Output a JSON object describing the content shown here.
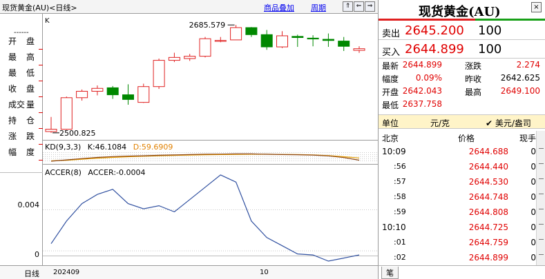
{
  "topbar": {
    "title": "现货黄金(AU)<日线>",
    "link_overlay": "商品叠加",
    "link_period": "周期"
  },
  "lefttoolbar": {
    "dash": "------",
    "items": [
      {
        "a": "开",
        "b": "盘"
      },
      {
        "a": "最",
        "b": "高"
      },
      {
        "a": "最",
        "b": "低"
      },
      {
        "a": "收",
        "b": "盘"
      },
      {
        "a": "成交",
        "b": "量"
      },
      {
        "a": "持",
        "b": "仓"
      },
      {
        "a": "涨",
        "b": "跌"
      },
      {
        "a": "幅",
        "b": "度"
      }
    ]
  },
  "bottombar": {
    "period": "日线",
    "date_start": "202409",
    "date_mid": "10"
  },
  "chart_data": {
    "type": "candlestick",
    "main_label": "K",
    "candles": [
      {
        "o": 2503,
        "h": 2528,
        "l": 2500.825,
        "c": 2507
      },
      {
        "o": 2507,
        "h": 2563,
        "l": 2506,
        "c": 2561
      },
      {
        "o": 2561,
        "h": 2575,
        "l": 2556,
        "c": 2572
      },
      {
        "o": 2572,
        "h": 2582,
        "l": 2565,
        "c": 2577
      },
      {
        "o": 2578,
        "h": 2581,
        "l": 2559,
        "c": 2566
      },
      {
        "o": 2566,
        "h": 2584,
        "l": 2549,
        "c": 2558
      },
      {
        "o": 2553,
        "h": 2585,
        "l": 2552,
        "c": 2580
      },
      {
        "o": 2580,
        "h": 2628,
        "l": 2576,
        "c": 2625
      },
      {
        "o": 2625,
        "h": 2638,
        "l": 2622,
        "c": 2630
      },
      {
        "o": 2628,
        "h": 2636,
        "l": 2624,
        "c": 2632
      },
      {
        "o": 2632,
        "h": 2665,
        "l": 2630,
        "c": 2662
      },
      {
        "o": 2658,
        "h": 2665,
        "l": 2656,
        "c": 2659
      },
      {
        "o": 2660,
        "h": 2685.579,
        "l": 2660,
        "c": 2681
      },
      {
        "o": 2681,
        "h": 2682,
        "l": 2665,
        "c": 2669
      },
      {
        "o": 2669,
        "h": 2677,
        "l": 2643,
        "c": 2648
      },
      {
        "o": 2648,
        "h": 2675,
        "l": 2646,
        "c": 2667
      },
      {
        "o": 2666,
        "h": 2669,
        "l": 2648,
        "c": 2664
      },
      {
        "o": 2663,
        "h": 2668,
        "l": 2649,
        "c": 2662
      },
      {
        "o": 2661,
        "h": 2671,
        "l": 2648,
        "c": 2659
      },
      {
        "o": 2658,
        "h": 2665,
        "l": 2641,
        "c": 2649
      },
      {
        "o": 2642.043,
        "h": 2649.1,
        "l": 2637.758,
        "c": 2644.899
      }
    ],
    "max_label": "2685.579",
    "min_label": "2500.825",
    "price_range": [
      2490,
      2700
    ],
    "kd": {
      "label": "KD(9,3,3)",
      "k_label": "K:46.1084",
      "d_label": "D:59.6909",
      "k": [
        40,
        48,
        56,
        63,
        68,
        71,
        73,
        76,
        78,
        80,
        82,
        83,
        84,
        84,
        82,
        80,
        79,
        77,
        72,
        62,
        46.1084
      ],
      "d": [
        42,
        46,
        52,
        58,
        63,
        67,
        70,
        73,
        75,
        77,
        79,
        80,
        81,
        82,
        82,
        81,
        80,
        78,
        74,
        67,
        59.6909
      ],
      "k_color": "#8b4513",
      "d_color": "#e8a000"
    },
    "accer": {
      "label": "ACCER(8)",
      "value_label": "ACCER:-0.0004",
      "values": [
        0.0007,
        0.0029,
        0.0046,
        0.0055,
        0.006,
        0.0046,
        0.0041,
        0.0044,
        0.0038,
        0.005,
        0.0062,
        0.0074,
        0.0067,
        0.0029,
        0.0013,
        0.0005,
        -0.0003,
        -0.0004,
        -0.001,
        -0.0007,
        -0.0004
      ],
      "ylim": [
        -0.0012,
        0.0082
      ],
      "ticks": [
        "0.004",
        "0"
      ],
      "color": "#3050a0"
    }
  },
  "rightpanel": {
    "title": "现货黄金(AU)",
    "close_icon": "×",
    "sell_label": "卖出",
    "sell_price": "2645.200",
    "sell_qty": "100",
    "buy_label": "买入",
    "buy_price": "2644.899",
    "buy_qty": "100",
    "stats": [
      {
        "k": "最新",
        "v": "2644.899",
        "vc": "#e00000",
        "k2": "涨跌",
        "v2": "2.274",
        "v2c": "#e00000"
      },
      {
        "k": "幅度",
        "v": "0.09%",
        "vc": "#e00000",
        "k2": "昨收",
        "v2": "2642.625",
        "v2c": "#000000"
      },
      {
        "k": "开盘",
        "v": "2642.043",
        "vc": "#e00000",
        "k2": "最高",
        "v2": "2649.100",
        "v2c": "#e00000"
      },
      {
        "k": "最低",
        "v": "2637.758",
        "vc": "#e00000",
        "k2": "",
        "v2": "",
        "v2c": "#000000"
      }
    ],
    "unit_label": "单位",
    "unit_value": "元/克",
    "unit_check": "✔ 美元/盎司",
    "col_time": "北京",
    "col_price": "价格",
    "col_hand": "现手",
    "ticks": [
      {
        "t": "10:09",
        "sub": false,
        "p": "2644.688",
        "h": "0"
      },
      {
        "t": ":56",
        "sub": true,
        "p": "2644.440",
        "h": "0"
      },
      {
        "t": ":57",
        "sub": true,
        "p": "2644.530",
        "h": "0"
      },
      {
        "t": ":58",
        "sub": true,
        "p": "2644.748",
        "h": "0"
      },
      {
        "t": ":59",
        "sub": true,
        "p": "2644.808",
        "h": "0"
      },
      {
        "t": "10:10",
        "sub": false,
        "p": "2644.725",
        "h": "0"
      },
      {
        "t": ":01",
        "sub": true,
        "p": "2644.759",
        "h": "0"
      },
      {
        "t": ":02",
        "sub": true,
        "p": "2644.899",
        "h": "0"
      }
    ],
    "foot_tab": "笔"
  }
}
